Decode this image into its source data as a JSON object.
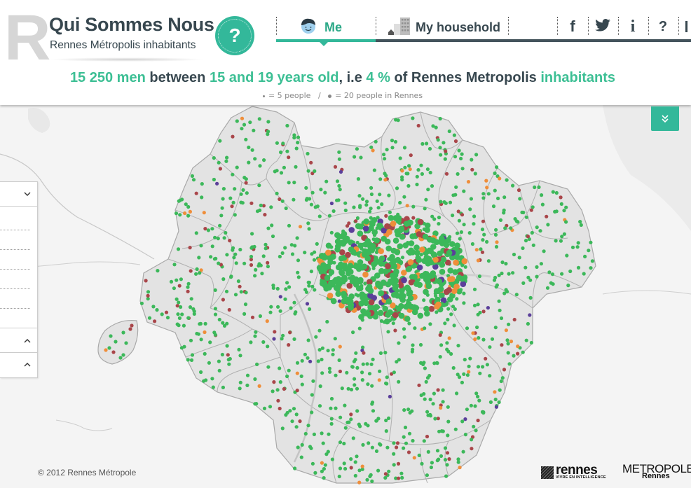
{
  "header": {
    "logo_letter": "R",
    "title": "Qui Sommes Nous",
    "subtitle": "Rennes Métropolis inhabitants",
    "help_button": "?"
  },
  "nav": {
    "tabs": [
      {
        "label": "Me",
        "icon": "boy-face-icon",
        "active": true
      },
      {
        "label": "My household",
        "icon": "buildings-icon",
        "active": false
      }
    ],
    "social": [
      {
        "name": "facebook",
        "glyph": "f"
      },
      {
        "name": "twitter",
        "glyph": "twitter"
      },
      {
        "name": "info",
        "glyph": "i"
      },
      {
        "name": "help",
        "glyph": "?"
      }
    ]
  },
  "headline": {
    "count": "15 250 men",
    "between": "between",
    "age_range": "15 and 19 years old",
    "ie": ", i.e",
    "percent": "4 %",
    "of": "of Rennes Metropolis",
    "inhabitants": "inhabitants"
  },
  "legend": {
    "small_dot": "= 5 people",
    "separator": "/",
    "big_dot": "= 20 people in Rennes"
  },
  "map": {
    "dot_colors": {
      "green": "#3cb85a",
      "red": "#a9464a",
      "orange": "#ef8e3a",
      "purple": "#5b3f9a"
    },
    "collapse_glyph": "»",
    "panel": {
      "chevron_down": "⌄",
      "chevron_up": "⌃"
    }
  },
  "footer": {
    "copyright": "© 2012 Rennes Métropole",
    "logo_rennes_word": "rennes",
    "logo_rennes_tagline": "VIVRE EN INTELLIGENCE",
    "logo_metropole_top": "METROPOLE",
    "logo_metropole_bottom": "Rennes"
  },
  "colors": {
    "accent": "#33b89a",
    "text_dark": "#37474f",
    "highlight": "#3cbf94"
  }
}
